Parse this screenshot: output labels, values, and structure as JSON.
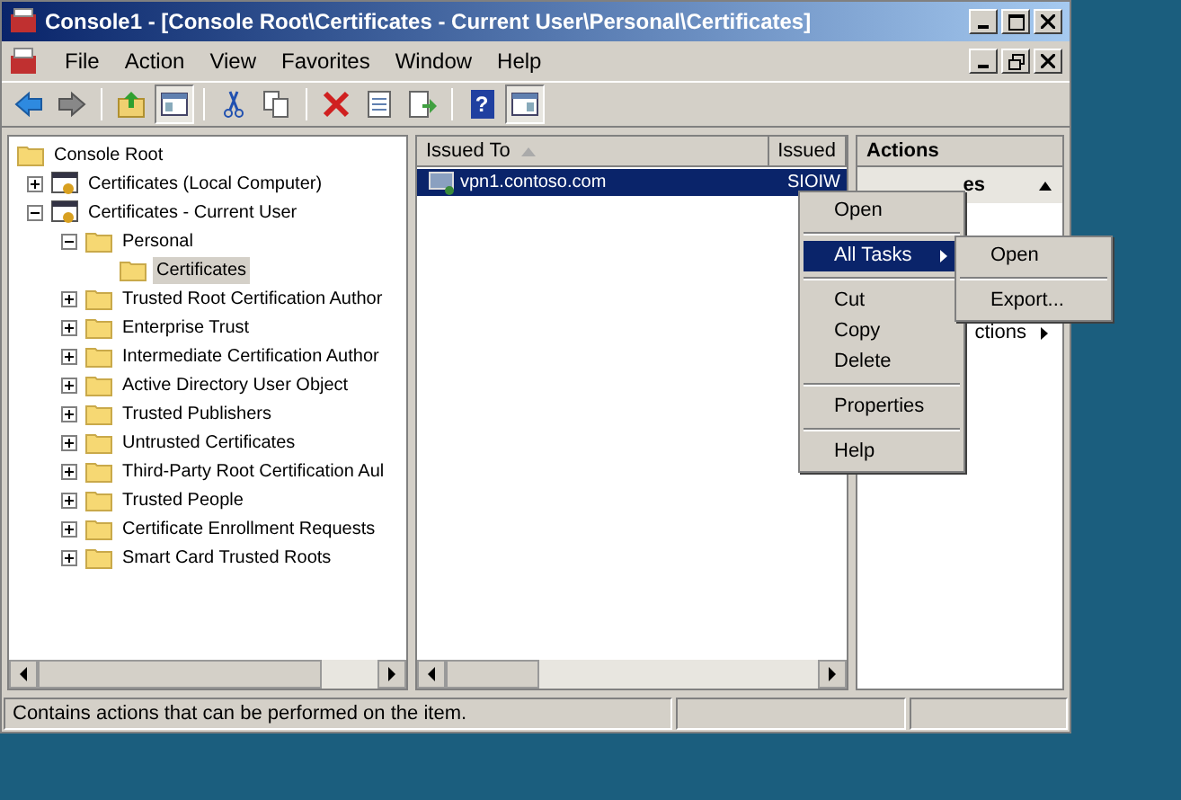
{
  "window": {
    "title": "Console1 - [Console Root\\Certificates - Current User\\Personal\\Certificates]"
  },
  "menu_bar": [
    "File",
    "Action",
    "View",
    "Favorites",
    "Window",
    "Help"
  ],
  "toolbar": {
    "help_glyph": "?"
  },
  "tree": [
    {
      "label": "Console Root",
      "kind": "folder",
      "selected": false,
      "children": [
        {
          "label": "Certificates (Local Computer)",
          "kind": "cert",
          "selected": false,
          "expanded": false
        },
        {
          "label": "Certificates - Current User",
          "kind": "cert",
          "selected": false,
          "expanded": true,
          "children": [
            {
              "label": "Personal",
              "kind": "folder",
              "selected": false,
              "expanded": true,
              "children": [
                {
                  "label": "Certificates",
                  "kind": "folder",
                  "selected": true
                }
              ]
            },
            {
              "label": "Trusted Root Certification Author",
              "kind": "folder",
              "selected": false,
              "expanded": false
            },
            {
              "label": "Enterprise Trust",
              "kind": "folder",
              "selected": false,
              "expanded": false
            },
            {
              "label": "Intermediate Certification Author",
              "kind": "folder",
              "selected": false,
              "expanded": false
            },
            {
              "label": "Active Directory User Object",
              "kind": "folder",
              "selected": false,
              "expanded": false
            },
            {
              "label": "Trusted Publishers",
              "kind": "folder",
              "selected": false,
              "expanded": false
            },
            {
              "label": "Untrusted Certificates",
              "kind": "folder",
              "selected": false,
              "expanded": false
            },
            {
              "label": "Third-Party Root Certification Aul",
              "kind": "folder",
              "selected": false,
              "expanded": false
            },
            {
              "label": "Trusted People",
              "kind": "folder",
              "selected": false,
              "expanded": false
            },
            {
              "label": "Certificate Enrollment Requests",
              "kind": "folder",
              "selected": false,
              "expanded": false
            },
            {
              "label": "Smart Card Trusted Roots",
              "kind": "folder",
              "selected": false,
              "expanded": false
            }
          ]
        }
      ]
    }
  ],
  "list": {
    "columns": [
      "Issued To",
      "Issued"
    ],
    "rows": [
      {
        "cells": [
          "vpn1.contoso.com",
          "SIOIW"
        ],
        "selected": true
      }
    ]
  },
  "actions": {
    "title": "Actions",
    "section": "es",
    "items": [
      "ctions"
    ]
  },
  "context_menu": [
    {
      "kind": "item",
      "label": "Open",
      "selected": false
    },
    {
      "kind": "separator"
    },
    {
      "kind": "submenu",
      "label": "All Tasks",
      "selected": true
    },
    {
      "kind": "separator"
    },
    {
      "kind": "item",
      "label": "Cut",
      "selected": false
    },
    {
      "kind": "item",
      "label": "Copy",
      "selected": false
    },
    {
      "kind": "item",
      "label": "Delete",
      "selected": false
    },
    {
      "kind": "separator"
    },
    {
      "kind": "item",
      "label": "Properties",
      "selected": false
    },
    {
      "kind": "separator"
    },
    {
      "kind": "item",
      "label": "Help",
      "selected": false
    }
  ],
  "submenu": [
    {
      "kind": "item",
      "label": "Open",
      "selected": false
    },
    {
      "kind": "separator"
    },
    {
      "kind": "item",
      "label": "Export...",
      "selected": false
    }
  ],
  "status_bar": "Contains actions that can be performed on the item."
}
